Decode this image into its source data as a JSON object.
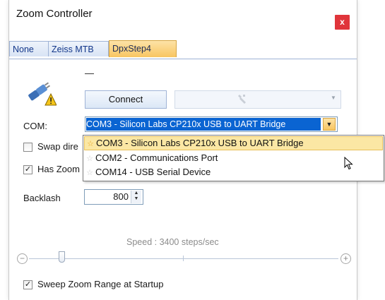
{
  "window": {
    "title": "Zoom Controller",
    "close_label": "x"
  },
  "tabs": [
    {
      "label": "None",
      "active": false
    },
    {
      "label": "Zeiss MTB",
      "active": false
    },
    {
      "label": "DpxStep4",
      "active": true
    }
  ],
  "status_text": "—",
  "device": {
    "icon": "plug-warning-icon"
  },
  "connect_label": "Connect",
  "settings_combo_icon": "wrench-icon",
  "com": {
    "label": "COM:",
    "selected": "COM3 - Silicon Labs CP210x USB to UART Bridge",
    "options": [
      {
        "label": "COM3 - Silicon Labs CP210x USB to UART Bridge",
        "favorite": true
      },
      {
        "label": "COM2 - Communications Port",
        "favorite": false
      },
      {
        "label": "COM14 - USB Serial Device",
        "favorite": false
      }
    ]
  },
  "swap_direction": {
    "label": "Swap dire",
    "checked": false
  },
  "has_zoom": {
    "label": "Has Zoom",
    "checked": true
  },
  "backlash": {
    "label": "Backlash",
    "value": "800"
  },
  "speed": {
    "label": "Speed : 3400 steps/sec",
    "minus": "−",
    "plus": "+"
  },
  "sweep": {
    "label": "Sweep Zoom Range at Startup",
    "checked": true
  }
}
